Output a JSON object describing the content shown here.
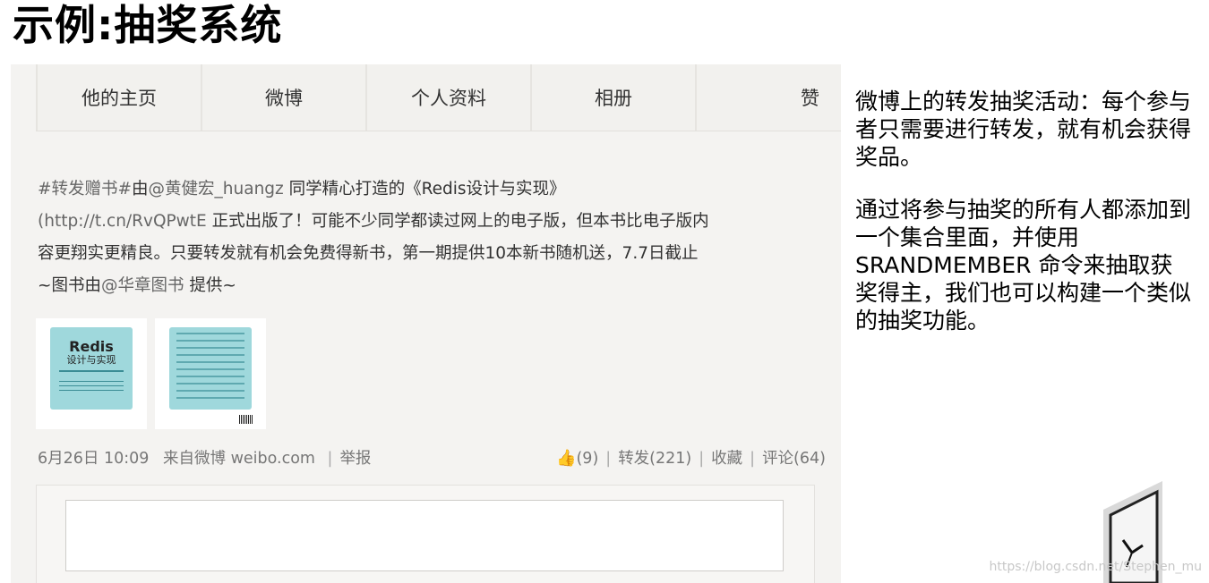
{
  "slide_title": "示例:抽奖系统",
  "weibo": {
    "tabs": [
      "他的主页",
      "微博",
      "个人资料",
      "相册",
      "赞"
    ],
    "post": {
      "line1_tag": "#转发赠书#",
      "line1_text": "由",
      "line1_user": "@黄健宏_huangz",
      "line1_rest": " 同学精心打造的《Redis设计与实现》",
      "line2_link": "(http://t.cn/RvQPwtE",
      "line2_rest": " 正式出版了！可能不少同学都读过网上的电子版，但本书比电子版内",
      "line3": "容更翔实更精良。只要转发就有机会免费得新书，第一期提供10本新书随机送，7.7日截止",
      "line4_start": "~图书由",
      "line4_user": "@华章图书",
      "line4_end": " 提供~"
    },
    "book_cover": {
      "title": "Redis",
      "subtitle": "设计与实现"
    },
    "meta": {
      "date": "6月26日 10:09",
      "source_label": "来自微博",
      "source_link": "weibo.com",
      "report": "举报",
      "like": "(9)",
      "repost": "转发(221)",
      "favorite": "收藏",
      "comment": "评论(64)"
    }
  },
  "side_text": {
    "para1": "微博上的转发抽奖活动：每个参与者只需要进行转发，就有机会获得奖品。",
    "para2": "通过将参与抽奖的所有人都添加到一个集合里面，并使用 SRANDMEMBER 命令来抽取获奖得主，我们也可以构建一个类似的抽奖功能。"
  },
  "watermark": "https://blog.csdn.net/Stephen_mu"
}
